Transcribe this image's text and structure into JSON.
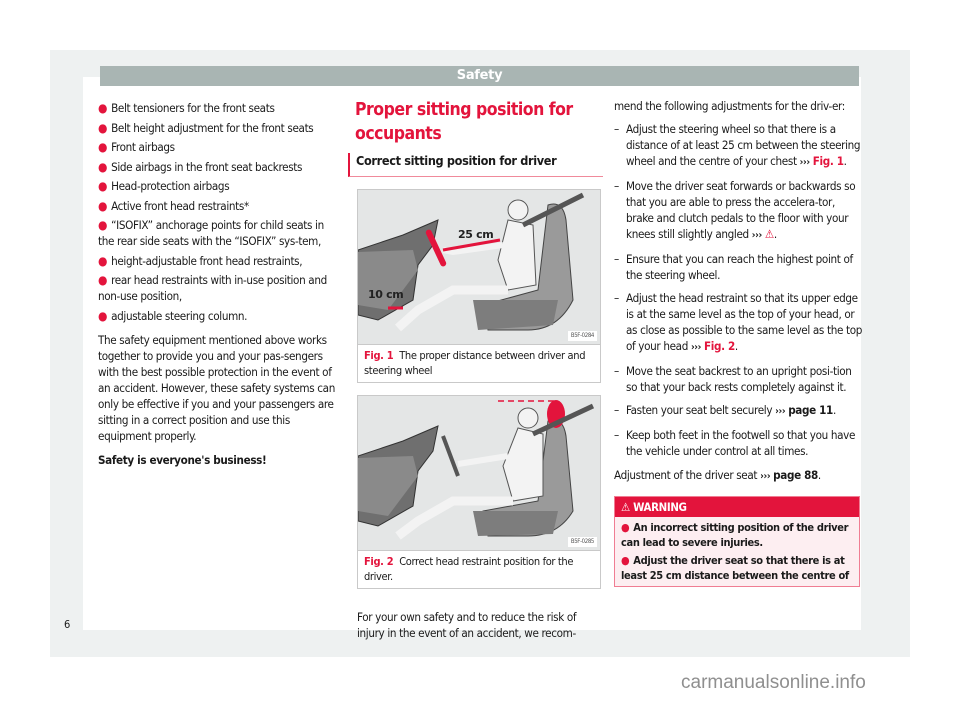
{
  "header": {
    "title": "Safety"
  },
  "col1": {
    "bullets": [
      "Belt tensioners for the front seats",
      "Belt height adjustment for the front seats",
      "Front airbags",
      "Side airbags in the front seat backrests",
      "Head-protection airbags",
      "Active front head restraints*",
      "“ISOFIX” anchorage points for child seats in the rear side seats with the “ISOFIX” sys-tem,",
      "height-adjustable front head restraints,",
      "rear head restraints with in-use position and non-use position,",
      "adjustable steering column."
    ],
    "paragraph": "The safety equipment mentioned above works together to provide you and your pas-sengers with the best possible protection in the event of an accident. However, these safety systems can only be effective if you and your passengers are sitting in a correct position and use this equipment properly.",
    "closing": "Safety is everyone's business!"
  },
  "col2": {
    "heading": "Proper sitting position for occupants",
    "subheading": "Correct sitting position for driver",
    "figures": [
      {
        "label": "Fig. 1",
        "caption": "The proper distance between driver and steering wheel",
        "code": "B5F-0284",
        "measure_a": "25 cm",
        "measure_b": "10 cm"
      },
      {
        "label": "Fig. 2",
        "caption": "Correct head restraint position for the driver.",
        "code": "B5F-0285"
      }
    ],
    "intro": "For your own safety and to reduce the risk of injury in the event of an accident, we recom-"
  },
  "col3": {
    "lead": "mend the following adjustments for the driv-er:",
    "steps": [
      {
        "text": "Adjust the steering wheel so that there is a distance of at least 25 cm between the steering wheel and the centre of your chest",
        "ref": "Fig. 1",
        "suffix": "."
      },
      {
        "text": "Move the driver seat forwards or backwards so that you are able to press the accelera-tor, brake and clutch pedals to the floor with your knees still slightly angled",
        "ref": "⚠",
        "suffix": "."
      },
      {
        "text": "Ensure that you can reach the highest point of the steering wheel.",
        "ref": "",
        "suffix": ""
      },
      {
        "text": "Adjust the head restraint so that its upper edge is at the same level as the top of your head, or as close as possible to the same level as the top of your head",
        "ref": "Fig. 2",
        "suffix": "."
      },
      {
        "text": "Move the seat backrest to an upright posi-tion so that your back rests completely against it.",
        "ref": "",
        "suffix": ""
      },
      {
        "text": "Fasten your seat belt securely",
        "ref": "page 11",
        "suffix": "."
      },
      {
        "text": "Keep both feet in the footwell so that you have the vehicle under control at all times.",
        "ref": "",
        "suffix": ""
      }
    ],
    "note_text": "Adjustment of the driver seat",
    "note_ref": "page 88",
    "note_suffix": ".",
    "arrows": "›››",
    "dash": "–",
    "warning": {
      "title": "WARNING",
      "items": [
        "An incorrect sitting position of the driver can lead to severe injuries.",
        "Adjust the driver seat so that there is at least 25 cm distance between the centre of"
      ]
    }
  },
  "footer": {
    "page_number": "6"
  },
  "watermark": "carmanualsonline.info",
  "colors": {
    "accent": "#e3143c",
    "header_bar": "#a9b5b3",
    "warning_bg": "#fdeef1",
    "frame": "#eef1f1"
  }
}
